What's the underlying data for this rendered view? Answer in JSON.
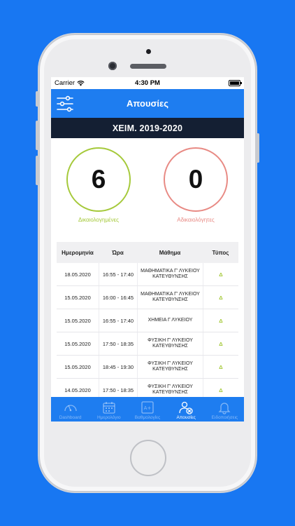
{
  "status": {
    "carrier": "Carrier",
    "time": "4:30 PM"
  },
  "header": {
    "title": "Απουσίες"
  },
  "semester": "ΧΕΙΜ. 2019-2020",
  "summary": {
    "justified": {
      "count": "6",
      "label": "Δικαιολογημένες",
      "color": "#a5c93a"
    },
    "unjustified": {
      "count": "0",
      "label": "Αδικαιολόγητες",
      "color": "#e88a84"
    }
  },
  "table": {
    "headers": [
      "Ημερομηνία",
      "Ώρα",
      "Μάθημα",
      "Τύπος"
    ],
    "rows": [
      {
        "date": "18.05.2020",
        "time": "16:55 - 17:40",
        "subject": "ΜΑΘΗΜΑΤΙΚΑ Γ' ΛΥΚΕΙΟΥ ΚΑΤΕΥΘΥΝΣΗΣ",
        "type": "Δ"
      },
      {
        "date": "15.05.2020",
        "time": "16:00 - 16:45",
        "subject": "ΜΑΘΗΜΑΤΙΚΑ Γ' ΛΥΚΕΙΟΥ ΚΑΤΕΥΘΥΝΣΗΣ",
        "type": "Δ"
      },
      {
        "date": "15.05.2020",
        "time": "16:55 - 17:40",
        "subject": "ΧΗΜΕΙΑ Γ ΛΥΚΕΙΟΥ",
        "type": "Δ"
      },
      {
        "date": "15.05.2020",
        "time": "17:50 - 18:35",
        "subject": "ΦΥΣΙΚΗ Γ' ΛΥΚΕΙΟΥ ΚΑΤΕΥΘΥΝΣΗΣ",
        "type": "Δ"
      },
      {
        "date": "15.05.2020",
        "time": "18:45 - 19:30",
        "subject": "ΦΥΣΙΚΗ Γ' ΛΥΚΕΙΟΥ ΚΑΤΕΥΘΥΝΣΗΣ",
        "type": "Δ"
      },
      {
        "date": "14.05.2020",
        "time": "17:50 - 18:35",
        "subject": "ΦΥΣΙΚΗ Γ' ΛΥΚΕΙΟΥ ΚΑΤΕΥΘΥΝΣΗΣ",
        "type": "Δ"
      }
    ]
  },
  "tabbar": {
    "items": [
      {
        "label": "Dashboard",
        "icon": "gauge-icon",
        "active": false
      },
      {
        "label": "Ημερολόγιο",
        "icon": "calendar-icon",
        "active": false
      },
      {
        "label": "Βαθμολογίες",
        "icon": "grade-icon",
        "active": false
      },
      {
        "label": "Απουσίες",
        "icon": "absence-icon",
        "active": true
      },
      {
        "label": "Ειδοποιήσεις",
        "icon": "bell-icon",
        "active": false
      }
    ]
  },
  "colors": {
    "background": "#1877f2",
    "nav": "#1e7df0",
    "semester_bar": "#141f33"
  }
}
